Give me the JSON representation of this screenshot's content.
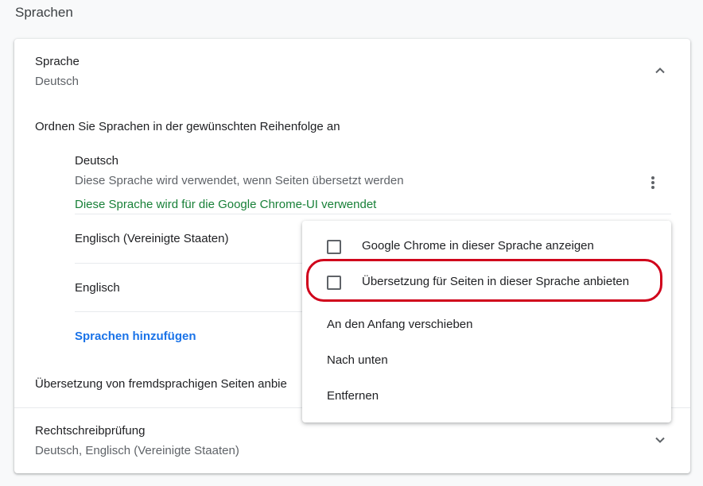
{
  "page": {
    "heading": "Sprachen"
  },
  "language_section": {
    "title": "Sprache",
    "subtitle": "Deutsch",
    "order_label": "Ordnen Sie Sprachen in der gewünschten Reihenfolge an",
    "languages": [
      {
        "name": "Deutsch",
        "note": "Diese Sprache wird verwendet, wenn Seiten übersetzt werden",
        "ui_note": "Diese Sprache wird für die Google Chrome-UI verwendet"
      },
      {
        "name": "Englisch (Vereinigte Staaten)"
      },
      {
        "name": "Englisch"
      }
    ],
    "add_languages": "Sprachen hinzufügen",
    "translate_offer": "Übersetzung von fremdsprachigen Seiten anbie"
  },
  "spellcheck_section": {
    "title": "Rechtschreibprüfung",
    "subtitle": "Deutsch, Englisch (Vereinigte Staaten)"
  },
  "context_menu": {
    "items": [
      {
        "label": "Google Chrome in dieser Sprache anzeigen",
        "type": "checkbox",
        "checked": false
      },
      {
        "label": "Übersetzung für Seiten in dieser Sprache anbieten",
        "type": "checkbox",
        "checked": false,
        "highlighted": true
      },
      {
        "label": "An den Anfang verschieben",
        "type": "action"
      },
      {
        "label": "Nach unten",
        "type": "action"
      },
      {
        "label": "Entfernen",
        "type": "action"
      }
    ]
  },
  "icons": {
    "collapse": "chevron-up-icon",
    "expand": "chevron-down-icon",
    "more": "more-vert-icon"
  },
  "colors": {
    "accent": "#1a73e8",
    "ui_language_note": "#188038",
    "highlight": "#d0021b"
  }
}
